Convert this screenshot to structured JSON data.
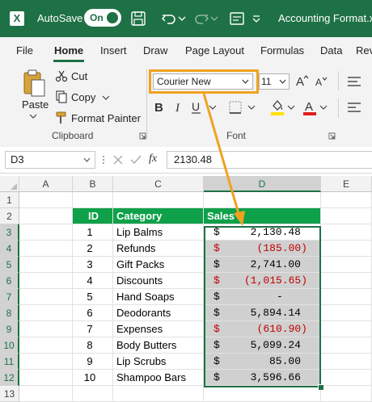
{
  "titlebar": {
    "autosave_label": "AutoSave",
    "autosave_state": "On",
    "document_title": "Accounting Format.xlsx",
    "app_color": "#1e7145"
  },
  "tabs": [
    "File",
    "Home",
    "Insert",
    "Draw",
    "Page Layout",
    "Formulas",
    "Data",
    "Rev"
  ],
  "active_tab": "Home",
  "ribbon": {
    "clipboard": {
      "paste_label": "Paste",
      "cut_label": "Cut",
      "copy_label": "Copy",
      "format_painter_label": "Format Painter",
      "group_label": "Clipboard"
    },
    "font": {
      "font_name": "Courier New",
      "font_size": "11",
      "group_label": "Font",
      "highlight_color": "#ffe000",
      "font_color": "#e0201b"
    },
    "annotation_color": "#f0a21f"
  },
  "formula_bar": {
    "name_box": "D3",
    "fx_label": "fx",
    "value": "2130.48"
  },
  "grid": {
    "columns": [
      "A",
      "B",
      "C",
      "D",
      "E"
    ],
    "selected_column": "D",
    "rows": [
      "1",
      "2",
      "3",
      "4",
      "5",
      "6",
      "7",
      "8",
      "9",
      "10",
      "11",
      "12",
      "13"
    ],
    "table_header": {
      "id": "ID",
      "category": "Category",
      "sales": "Sales"
    },
    "table_header_color": "#0fa04a",
    "negative_color": "#c00000",
    "currency_symbol": "$",
    "data": [
      {
        "id": "1",
        "category": "Lip Balms",
        "sales": "2,130.48",
        "negative": false
      },
      {
        "id": "2",
        "category": "Refunds",
        "sales": "(185.00)",
        "negative": true
      },
      {
        "id": "3",
        "category": "Gift Packs",
        "sales": "2,741.00",
        "negative": false
      },
      {
        "id": "4",
        "category": "Discounts",
        "sales": "(1,015.65)",
        "negative": true
      },
      {
        "id": "5",
        "category": "Hand Soaps",
        "sales": "-",
        "negative": false
      },
      {
        "id": "6",
        "category": "Deodorants",
        "sales": "5,894.14",
        "negative": false
      },
      {
        "id": "7",
        "category": "Expenses",
        "sales": "(610.90)",
        "negative": true
      },
      {
        "id": "8",
        "category": "Body Butters",
        "sales": "5,099.24",
        "negative": false
      },
      {
        "id": "9",
        "category": "Lip Scrubs",
        "sales": "85.00",
        "negative": false
      },
      {
        "id": "10",
        "category": "Shampoo Bars",
        "sales": "3,596.66",
        "negative": false
      }
    ]
  }
}
